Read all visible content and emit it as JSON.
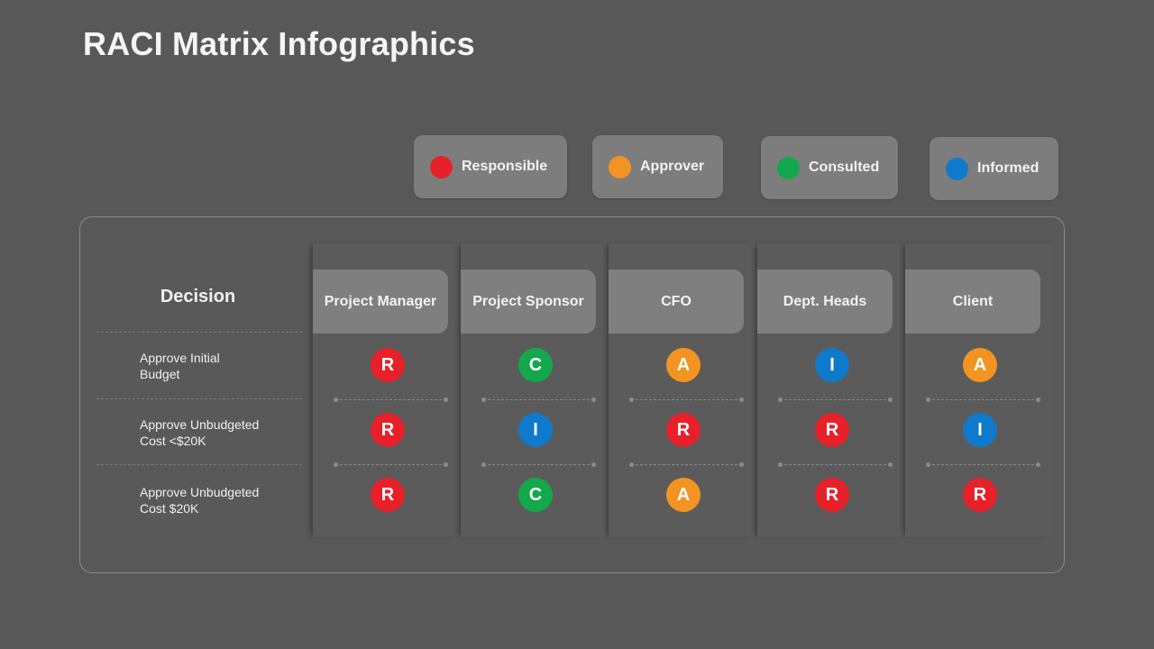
{
  "title": "RACI Matrix Infographics",
  "legend": [
    {
      "label": "Responsible",
      "code": "R",
      "color": "#e8202a"
    },
    {
      "label": "Approver",
      "code": "A",
      "color": "#f39322"
    },
    {
      "label": "Consulted",
      "code": "C",
      "color": "#12a84b"
    },
    {
      "label": "Informed",
      "code": "I",
      "color": "#0f7acb"
    }
  ],
  "matrix": {
    "decision_header": "Decision",
    "roles": [
      "Project Manager",
      "Project Sponsor",
      "CFO",
      "Dept. Heads",
      "Client"
    ],
    "rows": [
      {
        "decision": "Approve Initial Budget",
        "line1": "Approve Initial",
        "line2": "Budget",
        "assignments": [
          "R",
          "C",
          "A",
          "I",
          "A"
        ]
      },
      {
        "decision": "Approve Unbudgeted Cost <$20K",
        "line1": "Approve Unbudgeted",
        "line2": "Cost <$20K",
        "assignments": [
          "R",
          "I",
          "R",
          "R",
          "I"
        ]
      },
      {
        "decision": "Approve Unbudgeted Cost $20K",
        "line1": "Approve Unbudgeted",
        "line2": "Cost $20K",
        "assignments": [
          "R",
          "C",
          "A",
          "R",
          "R"
        ]
      }
    ]
  }
}
